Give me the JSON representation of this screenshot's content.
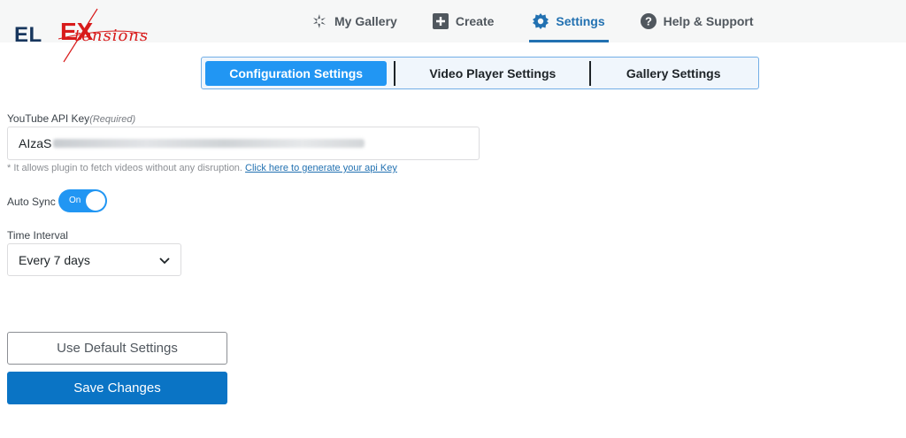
{
  "brand": {
    "logo_prefix": "EL",
    "logo_x": "EX",
    "logo_suffix": "tensions"
  },
  "nav": {
    "items": [
      {
        "label": "My Gallery",
        "icon": "gallery-icon"
      },
      {
        "label": "Create",
        "icon": "plus-square-icon"
      },
      {
        "label": "Settings",
        "icon": "gear-icon",
        "active": true
      },
      {
        "label": "Help & Support",
        "icon": "question-circle-icon"
      }
    ]
  },
  "subtabs": [
    {
      "label": "Configuration Settings",
      "active": true
    },
    {
      "label": "Video Player Settings"
    },
    {
      "label": "Gallery Settings"
    }
  ],
  "form": {
    "api_key_label": "YouTube API Key",
    "api_key_required": "(Required)",
    "api_key_value": "AIzaS",
    "hint_text": "* It allows plugin to fetch videos without any disruption.",
    "hint_link": "Click here to generate your api Key",
    "auto_sync_label": "Auto Sync",
    "auto_sync_state": "On",
    "time_interval_label": "Time Interval",
    "time_interval_value": "Every 7 days"
  },
  "buttons": {
    "default_label": "Use Default Settings",
    "save_label": "Save Changes"
  },
  "colors": {
    "accent": "#2196f3",
    "primary_button": "#0a74c5",
    "active_nav": "#2271b1",
    "logo_red": "#d81b1b",
    "logo_navy": "#17365d"
  }
}
